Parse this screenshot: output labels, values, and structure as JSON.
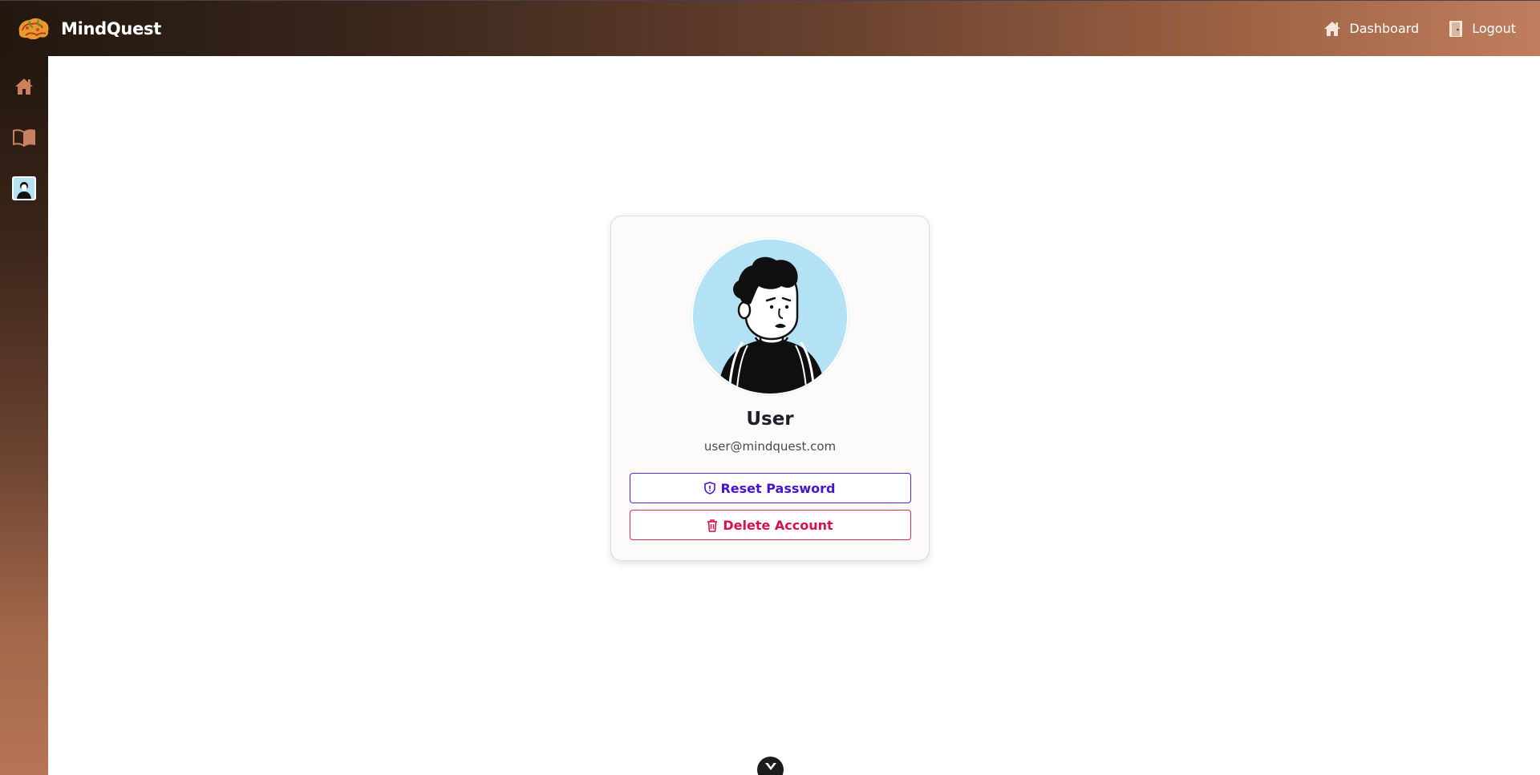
{
  "app": {
    "name": "MindQuest"
  },
  "nav": {
    "dashboard_label": "Dashboard",
    "logout_label": "Logout"
  },
  "sidebar": {
    "items": [
      {
        "icon": "home-icon"
      },
      {
        "icon": "book-icon"
      },
      {
        "icon": "avatar"
      }
    ]
  },
  "profile": {
    "name": "User",
    "email": "user@mindquest.com",
    "reset_password_label": "Reset Password",
    "delete_account_label": "Delete Account"
  },
  "colors": {
    "accent_reset": "#4b12d6",
    "accent_delete": "#dc1146",
    "avatar_bg": "#b3e2f5",
    "icon_tan": "#c9805f"
  }
}
